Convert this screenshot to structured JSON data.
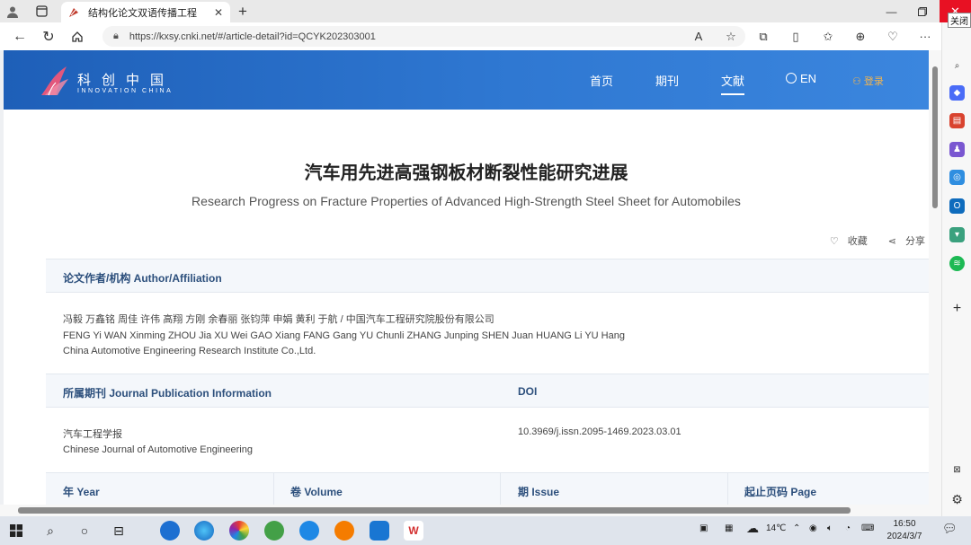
{
  "browser": {
    "tab_title": "结构化论文双语传播工程",
    "url": "https://kxsy.cnki.net/#/article-detail?id=QCYK202303001",
    "close_tooltip": "关闭"
  },
  "site": {
    "logo_cn": "科创中国",
    "logo_en": "INNOVATION CHINA",
    "nav": [
      "首页",
      "期刊",
      "文献"
    ],
    "lang": "EN",
    "login": "登录"
  },
  "article": {
    "title_cn": "汽车用先进高强钢板材断裂性能研究进展",
    "title_en": "Research Progress on Fracture Properties of Advanced High-Strength Steel Sheet for Automobiles",
    "favorite": "收藏",
    "share": "分享"
  },
  "authors": {
    "heading": "论文作者/机构 Author/Affiliation",
    "cn": "冯毅 万鑫铭 周佳 许伟 高翔 方刚 余春丽 张钧萍 申娟 黄利 于航 / 中国汽车工程研究院股份有限公司",
    "en": "FENG Yi WAN Xinming ZHOU Jia XU Wei GAO Xiang FANG Gang YU Chunli ZHANG Junping SHEN Juan HUANG Li YU Hang",
    "affiliation_en": "China Automotive Engineering Research Institute Co.,Ltd."
  },
  "journal": {
    "heading": "所属期刊 Journal Publication Information",
    "doi_heading": "DOI",
    "name_cn": "汽车工程学报",
    "name_en": "Chinese Journal of Automotive Engineering",
    "doi": "10.3969/j.issn.2095-1469.2023.03.01"
  },
  "meta_columns": [
    "年 Year",
    "卷 Volume",
    "期 Issue",
    "起止页码 Page"
  ],
  "taskbar": {
    "temperature": "14℃",
    "time": "16:50",
    "date": "2024/3/7"
  }
}
